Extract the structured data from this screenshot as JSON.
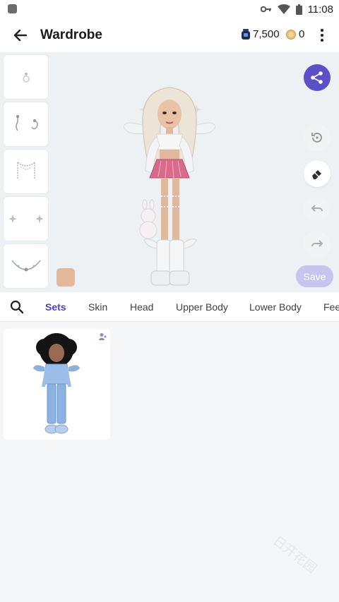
{
  "status_bar": {
    "time": "11:08"
  },
  "app_bar": {
    "title": "Wardrobe",
    "gems": "7,500",
    "coins": "0"
  },
  "stage": {
    "save_label": "Save",
    "skin_color": "#e2b89a",
    "accent": "#5b50c8"
  },
  "tabs": {
    "items": [
      {
        "label": "Sets",
        "active": true
      },
      {
        "label": "Skin",
        "active": false
      },
      {
        "label": "Head",
        "active": false
      },
      {
        "label": "Upper Body",
        "active": false
      },
      {
        "label": "Lower Body",
        "active": false
      },
      {
        "label": "Fee",
        "active": false
      }
    ]
  },
  "watermark": "日开花园"
}
